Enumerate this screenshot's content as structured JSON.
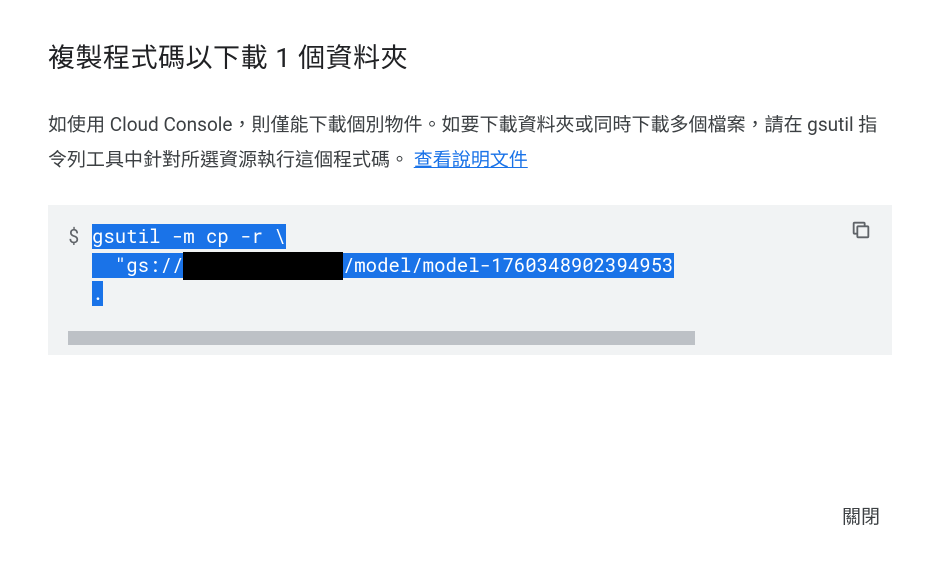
{
  "dialog": {
    "title": "複製程式碼以下載 1 個資料夾",
    "description_part1": "如使用 Cloud Console，則僅能下載個別物件。如要下載資料夾或同時下載多個檔案，請在 gsutil 指令列工具中針對所選資源執行這個程式碼。",
    "doc_link_text": "查看說明文件",
    "close_label": "關閉"
  },
  "code": {
    "prompt": "$",
    "line1": "gsutil -m cp -r \\",
    "line2_prefix": "  \"gs://",
    "line2_redacted": "              ",
    "line2_suffix": "/model/model-1760348902394953",
    "line3": "."
  }
}
